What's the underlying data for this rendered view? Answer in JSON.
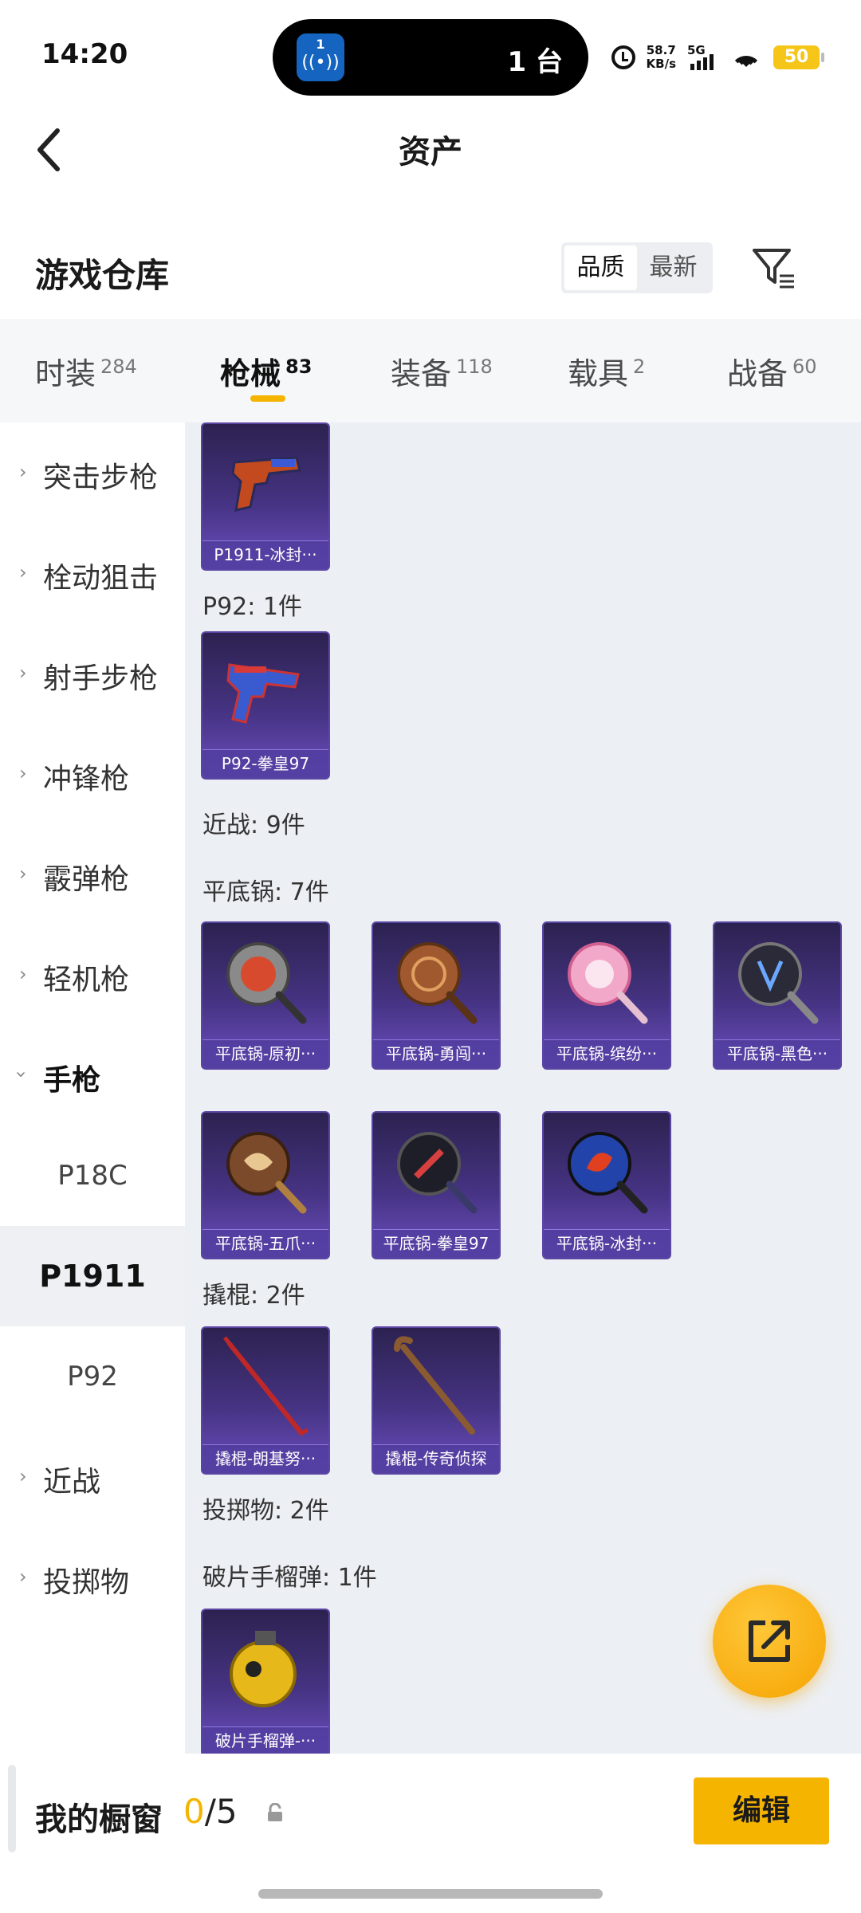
{
  "status_bar": {
    "time": "14:20",
    "island_badge": "1",
    "island_text": "1 台",
    "speed_value": "58.7",
    "speed_unit": "KB/s",
    "network": "5G",
    "battery": "50"
  },
  "header": {
    "title": "资产"
  },
  "warehouse": {
    "title": "游戏仓库",
    "sort": [
      "品质",
      "最新"
    ]
  },
  "tabs": [
    {
      "label": "时装",
      "count": "284"
    },
    {
      "label": "枪械",
      "count": "83"
    },
    {
      "label": "装备",
      "count": "118"
    },
    {
      "label": "载具",
      "count": "2"
    },
    {
      "label": "战备",
      "count": "60"
    }
  ],
  "sidebar": {
    "categories": [
      "突击步枪",
      "栓动狙击",
      "射手步枪",
      "冲锋枪",
      "霰弹枪",
      "轻机枪",
      "手枪"
    ],
    "pistol_subs": [
      "P18C",
      "P1911",
      "P92"
    ],
    "bottom_categories": [
      "近战",
      "投掷物"
    ]
  },
  "content": {
    "items": [
      "P1911-冰封···",
      "P92-拳皇97",
      "平底锅-原初···",
      "平底锅-勇闯···",
      "平底锅-缤纷···",
      "平底锅-黑色···",
      "平底锅-五爪···",
      "平底锅-拳皇97",
      "平底锅-冰封···",
      "撬棍-朗基努···",
      "撬棍-传奇侦探",
      "破片手榴弹-···"
    ],
    "labels": {
      "p92": "P92: 1件",
      "melee": "近战: 9件",
      "pan": "平底锅: 7件",
      "crowbar": "撬棍: 2件",
      "throwable": "投掷物: 2件",
      "grenade": "破片手榴弹: 1件"
    }
  },
  "bottom_bar": {
    "title": "我的橱窗",
    "current": "0",
    "slash_total": "/5",
    "edit_label": "编辑"
  },
  "colors": {
    "accent": "#f5b400",
    "item_bg": "#463383",
    "content_bg": "#eceff3"
  }
}
